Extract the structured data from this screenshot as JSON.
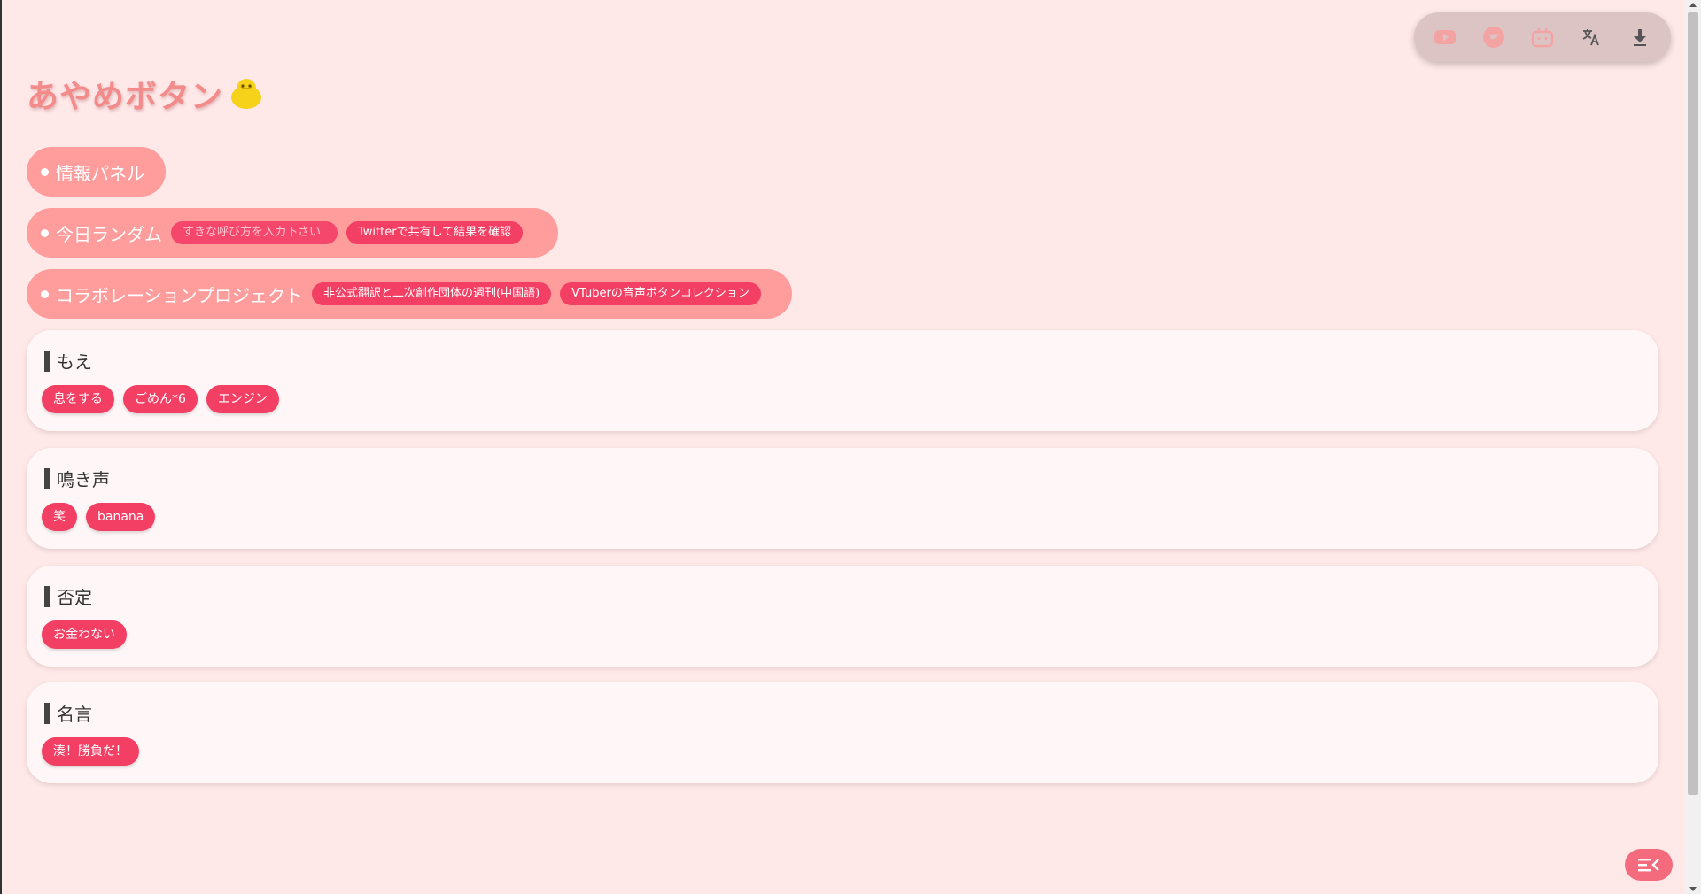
{
  "site": {
    "title": "あやめボタン"
  },
  "toolbar": {
    "icons": [
      "youtube-icon",
      "twitter-icon",
      "bilibili-icon",
      "translate-icon",
      "download-icon"
    ]
  },
  "info_panel": {
    "label": "情報パネル"
  },
  "daily_random": {
    "label": "今日ランダム",
    "input_placeholder": "すきな呼び方を入力下さい",
    "share_button": "Twitterで共有して結果を確認"
  },
  "collab": {
    "label": "コラボレーションプロジェクト",
    "links": [
      "非公式翻訳と二次創作団体の週刊(中国語)",
      "VTuberの音声ボタンコレクション"
    ]
  },
  "categories": [
    {
      "title": "もえ",
      "buttons": [
        "息をする",
        "ごめん*6",
        "エンジン"
      ]
    },
    {
      "title": "鳴き声",
      "buttons": [
        "笑",
        "banana"
      ]
    },
    {
      "title": "否定",
      "buttons": [
        "お金わない"
      ]
    },
    {
      "title": "名言",
      "buttons": [
        "湊！勝負だ！"
      ]
    }
  ],
  "colors": {
    "background": "#ffe8e8",
    "accent": "#f23f63",
    "pill": "#ff9d9d",
    "title": "#f48b8b"
  }
}
